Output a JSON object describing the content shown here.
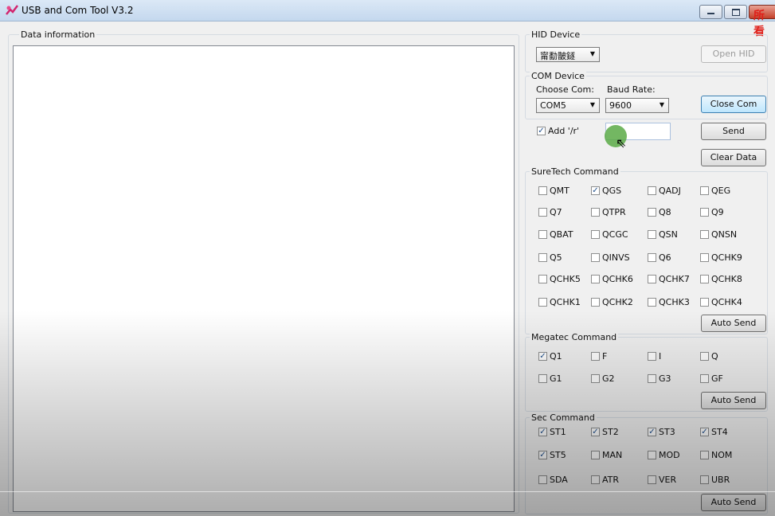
{
  "window": {
    "title": "USB and Com Tool V3.2",
    "overlay_glyph": "所看"
  },
  "data_info": {
    "label": "Data information"
  },
  "hid": {
    "label": "HID Device",
    "device_value": "甯勫皵鐩",
    "open_button": "Open HID"
  },
  "com": {
    "label": "COM Device",
    "choose_label": "Choose Com:",
    "baud_label": "Baud Rate:",
    "port_value": "COM5",
    "baud_value": "9600",
    "close_button": "Close Com"
  },
  "send_row": {
    "add_r_label": "Add '/r'",
    "add_r_checked": true,
    "input_value": "",
    "send_button": "Send",
    "clear_button": "Clear Data"
  },
  "suretech": {
    "label": "SureTech Command",
    "items": [
      {
        "label": "QMT",
        "checked": false
      },
      {
        "label": "QGS",
        "checked": true
      },
      {
        "label": "QADJ",
        "checked": false
      },
      {
        "label": "QEG",
        "checked": false
      },
      {
        "label": "Q7",
        "checked": false
      },
      {
        "label": "QTPR",
        "checked": false
      },
      {
        "label": "Q8",
        "checked": false
      },
      {
        "label": "Q9",
        "checked": false
      },
      {
        "label": "QBAT",
        "checked": false
      },
      {
        "label": "QCGC",
        "checked": false
      },
      {
        "label": "QSN",
        "checked": false
      },
      {
        "label": "QNSN",
        "checked": false
      },
      {
        "label": "Q5",
        "checked": false
      },
      {
        "label": "QINVS",
        "checked": false
      },
      {
        "label": "Q6",
        "checked": false
      },
      {
        "label": "QCHK9",
        "checked": false
      },
      {
        "label": "QCHK5",
        "checked": false
      },
      {
        "label": "QCHK6",
        "checked": false
      },
      {
        "label": "QCHK7",
        "checked": false
      },
      {
        "label": "QCHK8",
        "checked": false
      },
      {
        "label": "QCHK1",
        "checked": false
      },
      {
        "label": "QCHK2",
        "checked": false
      },
      {
        "label": "QCHK3",
        "checked": false
      },
      {
        "label": "QCHK4",
        "checked": false
      }
    ],
    "auto_send": "Auto Send"
  },
  "megatec": {
    "label": "Megatec Command",
    "items": [
      {
        "label": "Q1",
        "checked": true
      },
      {
        "label": "F",
        "checked": false
      },
      {
        "label": "I",
        "checked": false
      },
      {
        "label": "Q",
        "checked": false
      },
      {
        "label": "G1",
        "checked": false
      },
      {
        "label": "G2",
        "checked": false
      },
      {
        "label": "G3",
        "checked": false
      },
      {
        "label": "GF",
        "checked": false
      }
    ],
    "auto_send": "Auto Send"
  },
  "sec": {
    "label": "Sec Command",
    "items": [
      {
        "label": "ST1",
        "checked": true
      },
      {
        "label": "ST2",
        "checked": true
      },
      {
        "label": "ST3",
        "checked": true
      },
      {
        "label": "ST4",
        "checked": true
      },
      {
        "label": "ST5",
        "checked": true
      },
      {
        "label": "MAN",
        "checked": false
      },
      {
        "label": "MOD",
        "checked": false
      },
      {
        "label": "NOM",
        "checked": false
      },
      {
        "label": "SDA",
        "checked": false
      },
      {
        "label": "ATR",
        "checked": false
      },
      {
        "label": "VER",
        "checked": false
      },
      {
        "label": "UBR",
        "checked": false
      }
    ],
    "auto_send": "Auto Send"
  },
  "colors": {
    "accent_button": "#bee6fd",
    "checkmark": "#1f4f8c",
    "close_red": "#c4402a",
    "cursor_ring": "#5aaa46"
  }
}
